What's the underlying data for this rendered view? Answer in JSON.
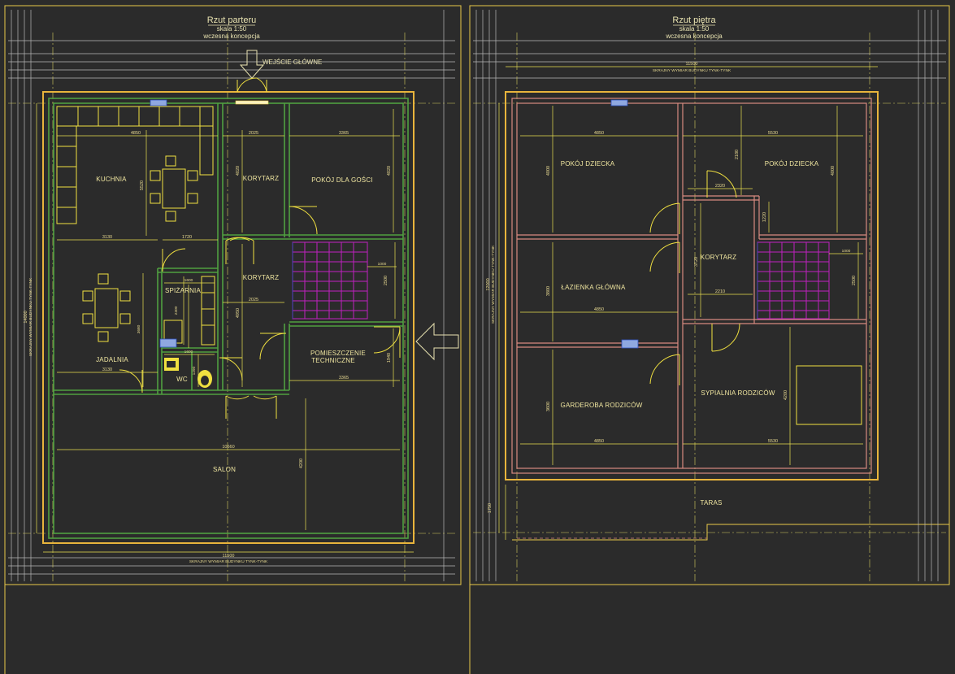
{
  "ground": {
    "title": "Rzut parteru",
    "scale": "skala 1:50",
    "concept": "wczesna koncepcja",
    "entrance": "WEJŚCIE GŁÓWNE",
    "rooms": {
      "kuchnia": "KUCHNIA",
      "korytarz1": "KORYTARZ",
      "pokoj_goscie": "POKÓJ DLA GOŚCI",
      "korytarz2": "KORYTARZ",
      "spizarnia": "SPIŻARNIA",
      "jadalnia": "JADALNIA",
      "wc": "WC",
      "pomieszczenie1": "POMIESZCZENIE",
      "pomieszczenie2": "TECHNICZNE",
      "salon": "SALON"
    },
    "dims": {
      "d4850": "4850",
      "d2025a": "2025",
      "d3365a": "3365",
      "d5520": "5520",
      "d4020a": "4020",
      "d4020b": "4020",
      "d3130a": "3130",
      "d1720": "1720",
      "d1600a": "1600",
      "d2025b": "2025",
      "d1000": "1000",
      "d2500": "2500",
      "d2300": "2300",
      "d3680": "3680",
      "d4950": "4950",
      "d1600b": "1600",
      "d1290": "1290",
      "d3130b": "3130",
      "d3365b": "3365",
      "d1940": "1940",
      "d10660": "10660",
      "d4200": "4200",
      "d14000": "14000",
      "d11500": "11500"
    },
    "bottom_note": "SKRAJNY WYMIAR BUDYNKU TYNK-TYNK",
    "side_note": "SKRAJNY WYMIAR BUDYNKU TYNK-TYNK"
  },
  "upper": {
    "title": "Rzut piętra",
    "scale": "skala 1:50",
    "concept": "wczesna koncepcja",
    "top_dim": "11500",
    "top_note": "SKRAJNY WYMIAR BUDYNKU TYNK-TYNK",
    "rooms": {
      "pokoj1": "POKÓJ DZIECKA",
      "pokoj2": "POKÓJ DZIECKA",
      "korytarz": "KORYTARZ",
      "lazienka": "ŁAZIENKA GŁÓWNA",
      "garderoba": "GARDEROBA RODZICÓW",
      "sypialnia": "SYPIALNIA RODZICÓW",
      "taras": "TARAS"
    },
    "dims": {
      "d4850a": "4850",
      "d5530a": "5530",
      "d4000a": "4000",
      "d2180": "2180",
      "d4000b": "4000",
      "d2320": "2320",
      "d1220": "1220",
      "d1000": "1000",
      "d2500": "2500",
      "d3720": "3720",
      "d2210": "2210",
      "d3800": "3800",
      "d4850b": "4850",
      "d3600": "3600",
      "d4200": "4200",
      "d4850c": "4850",
      "d5530b": "5530",
      "d12000": "12000",
      "d1750": "1750"
    },
    "side_note": "SKRAJNY WYMIAR BUDYNKU TYNK-TYNK"
  },
  "colors": {
    "background": "#2b2b2b",
    "outer_wall": "#e8b43c",
    "inner_wall_ground": "#4fa040",
    "inner_wall_upper": "#d88a80",
    "dimension": "#e8e050",
    "stairs": "#c020c0"
  }
}
